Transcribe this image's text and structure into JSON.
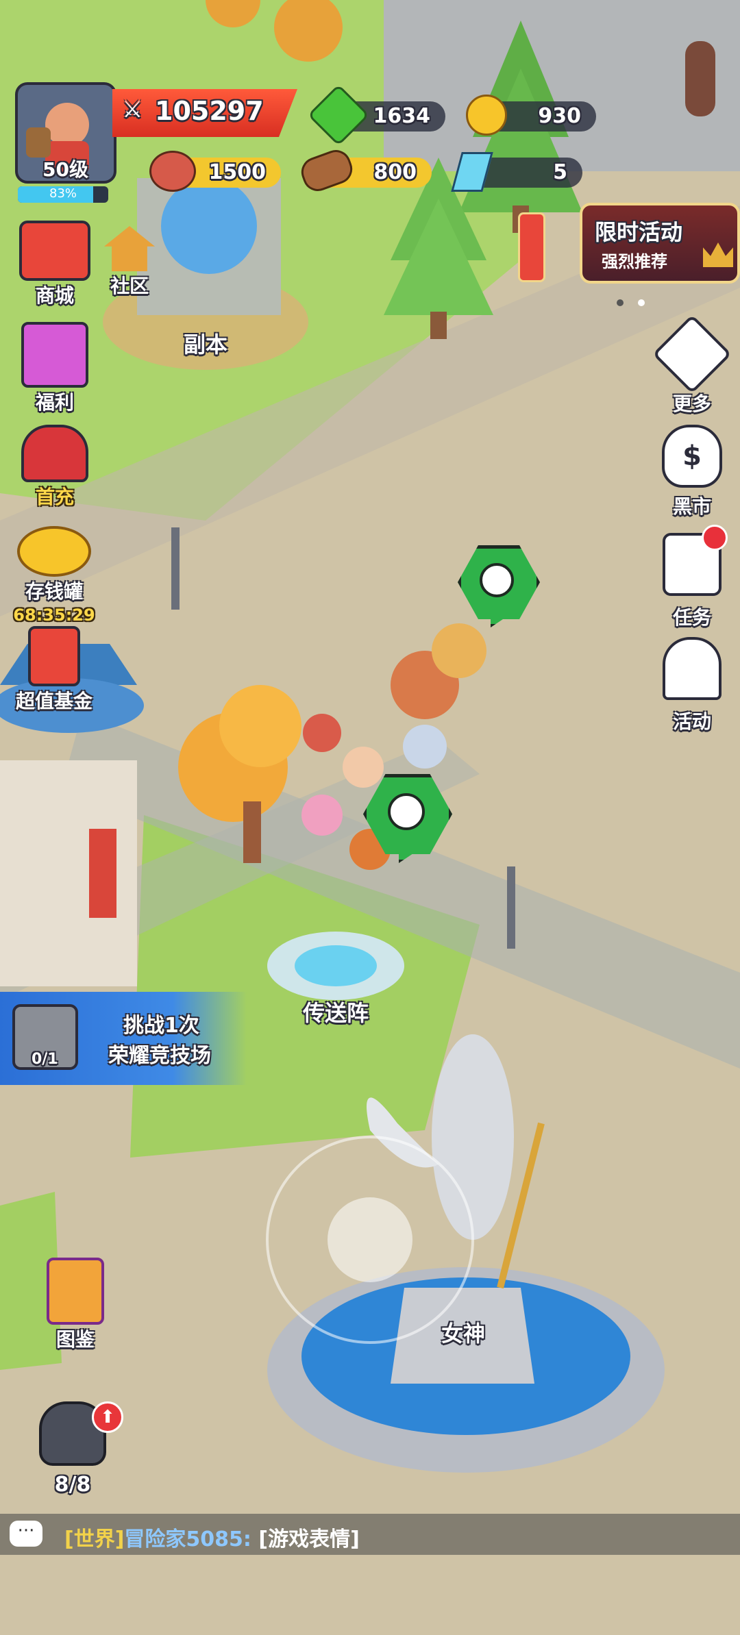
{
  "player": {
    "level_label": "50级",
    "exp_percent_label": "83%",
    "exp_fraction": 0.83,
    "power": "105297"
  },
  "resources": {
    "gems": "1634",
    "gold": "930",
    "meat": "1500",
    "wood": "800",
    "crystal": "5"
  },
  "event_banner": {
    "title": "限时活动",
    "subtitle": "强烈推荐"
  },
  "left_menu": {
    "shop": "商城",
    "community": "社区",
    "welfare": "福利",
    "first_charge": "首充",
    "piggy_bank": "存钱罐",
    "piggy_timer": "68:35:29",
    "fund": "超值基金",
    "codex": "图鉴",
    "heroes_count": "8/8"
  },
  "right_menu": {
    "more": "更多",
    "black_market": "黑市",
    "tasks": "任务",
    "events": "活动"
  },
  "map_labels": {
    "dungeon": "副本",
    "portal": "传送阵",
    "goddess": "女神"
  },
  "quest": {
    "line1": "挑战1次",
    "line2": "荣耀竞技场",
    "progress": "0/1"
  },
  "chat": {
    "channel": "[世界]",
    "sender": "冒险家5085:",
    "message": "[游戏表情]"
  },
  "colors": {
    "grass": "#a9d46a",
    "path": "#d9c9a4",
    "quest_blue": "#2b6fd6",
    "pin_green": "#2fb24a",
    "power_banner": "#e83a2e"
  }
}
